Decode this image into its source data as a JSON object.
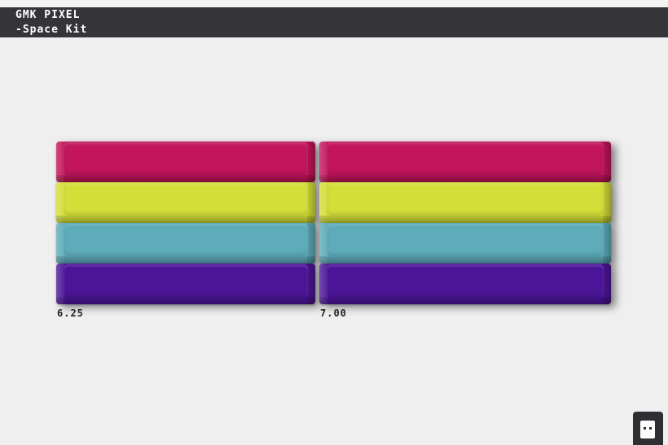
{
  "header": {
    "title_line1": "GMK PIXEL",
    "title_line2": "-Space Kit"
  },
  "keys": {
    "colors": {
      "magenta": "#c2155a",
      "yellow": "#d3de38",
      "cyan": "#5eabba",
      "purple": "#4c1598"
    },
    "columns": [
      {
        "size_label": "6.25"
      },
      {
        "size_label": "7.00"
      }
    ]
  },
  "mascot": {
    "icon": "pixel-ghost-icon"
  }
}
